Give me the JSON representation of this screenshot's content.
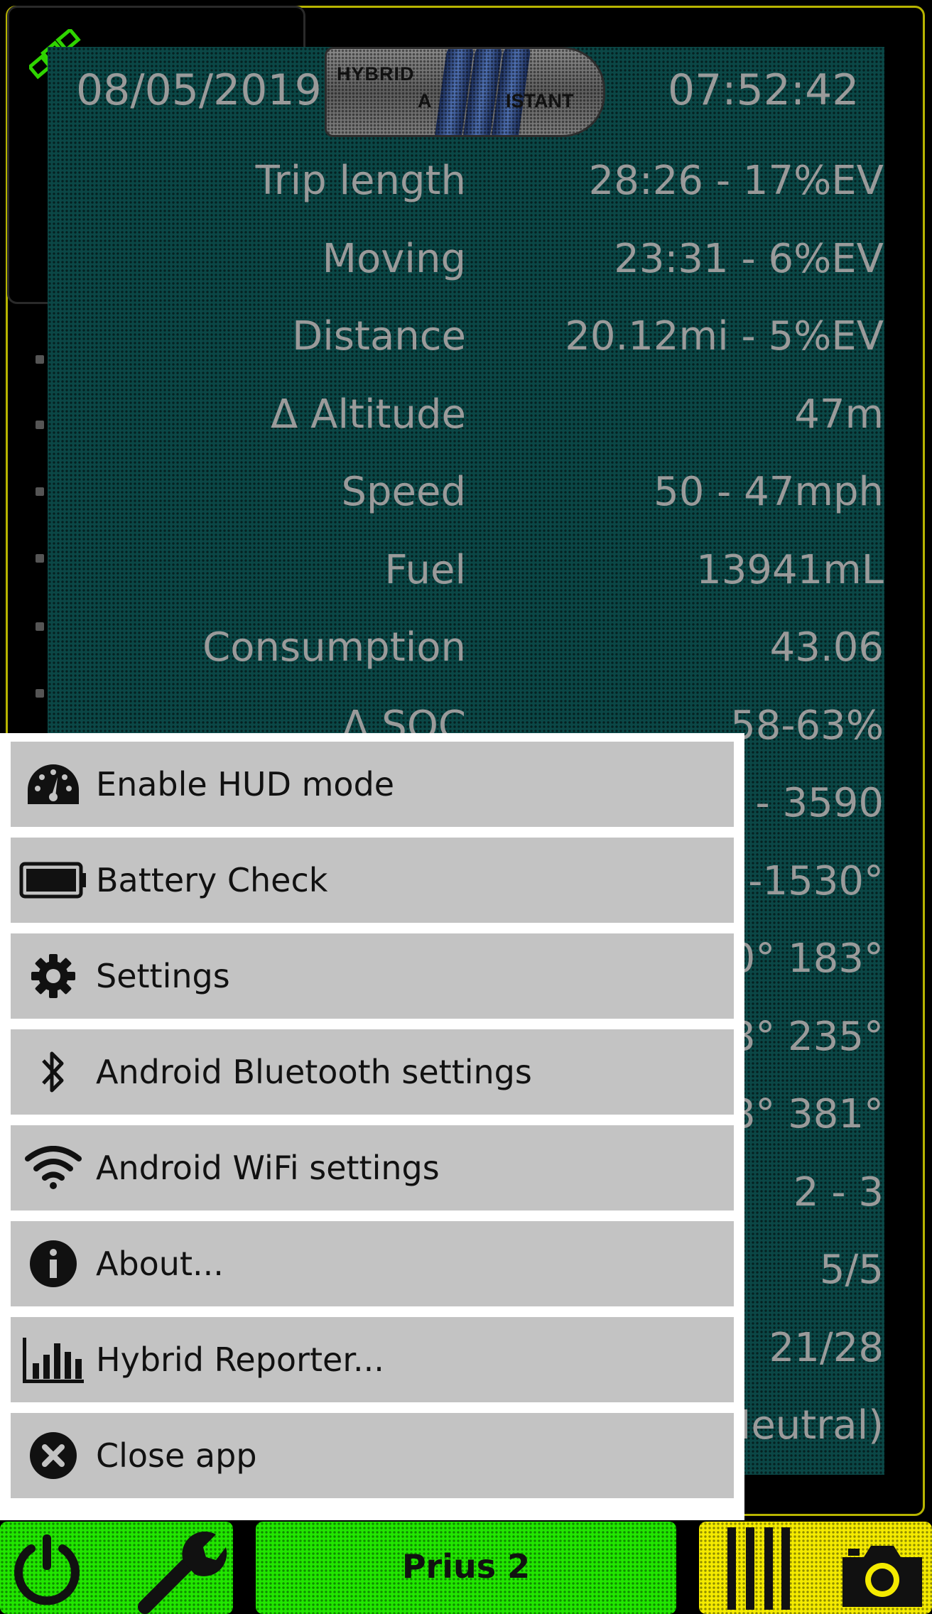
{
  "header": {
    "date": "08/05/2019",
    "time": "07:52:42",
    "logo_text_1": "HYBRID",
    "logo_text_2": "A",
    "logo_text_3": "ISTANT"
  },
  "stats": [
    {
      "label": "Trip length",
      "value": "28:26 - 17%EV"
    },
    {
      "label": "Moving",
      "value": "23:31 - 6%EV"
    },
    {
      "label": "Distance",
      "value": "20.12mi - 5%EV"
    },
    {
      "label": "Δ Altitude",
      "value": "47m"
    },
    {
      "label": "Speed",
      "value": "50 - 47mph"
    },
    {
      "label": "Fuel",
      "value": "13941mL"
    },
    {
      "label": "Consumption",
      "value": "43.06"
    },
    {
      "label": "Δ SOC",
      "value": "58-63%"
    },
    {
      "label": "",
      "value": ") - 3590"
    },
    {
      "label": "",
      "value": "' -1530°"
    },
    {
      "label": "",
      "value": "'0° 183°"
    },
    {
      "label": "",
      "value": "38° 235°"
    },
    {
      "label": "",
      "value": "38° 381°"
    },
    {
      "label": "",
      "value": "2 - 3"
    },
    {
      "label": "",
      "value": "5/5"
    },
    {
      "label": "",
      "value": "21/28"
    },
    {
      "label": "",
      "value": "Neutral)"
    }
  ],
  "menu": {
    "items": [
      {
        "label": "Enable HUD mode",
        "icon": "speedometer-icon"
      },
      {
        "label": "Battery Check",
        "icon": "battery-icon"
      },
      {
        "label": "Settings",
        "icon": "gear-icon"
      },
      {
        "label": "Android Bluetooth settings",
        "icon": "bluetooth-icon"
      },
      {
        "label": "Android WiFi settings",
        "icon": "wifi-icon"
      },
      {
        "label": "About...",
        "icon": "info-icon"
      },
      {
        "label": "Hybrid Reporter...",
        "icon": "bar-chart-icon"
      },
      {
        "label": "Close app",
        "icon": "close-circle-icon"
      }
    ]
  },
  "bottom_bar": {
    "vehicle_label": "Prius 2"
  },
  "colors": {
    "panel": "#0b4746",
    "text": "#9a9a9a",
    "menu_item": "#c3c3c3",
    "green_button": "#22e600",
    "yellow_button": "#f4ea00",
    "frame": "#b7b400"
  }
}
